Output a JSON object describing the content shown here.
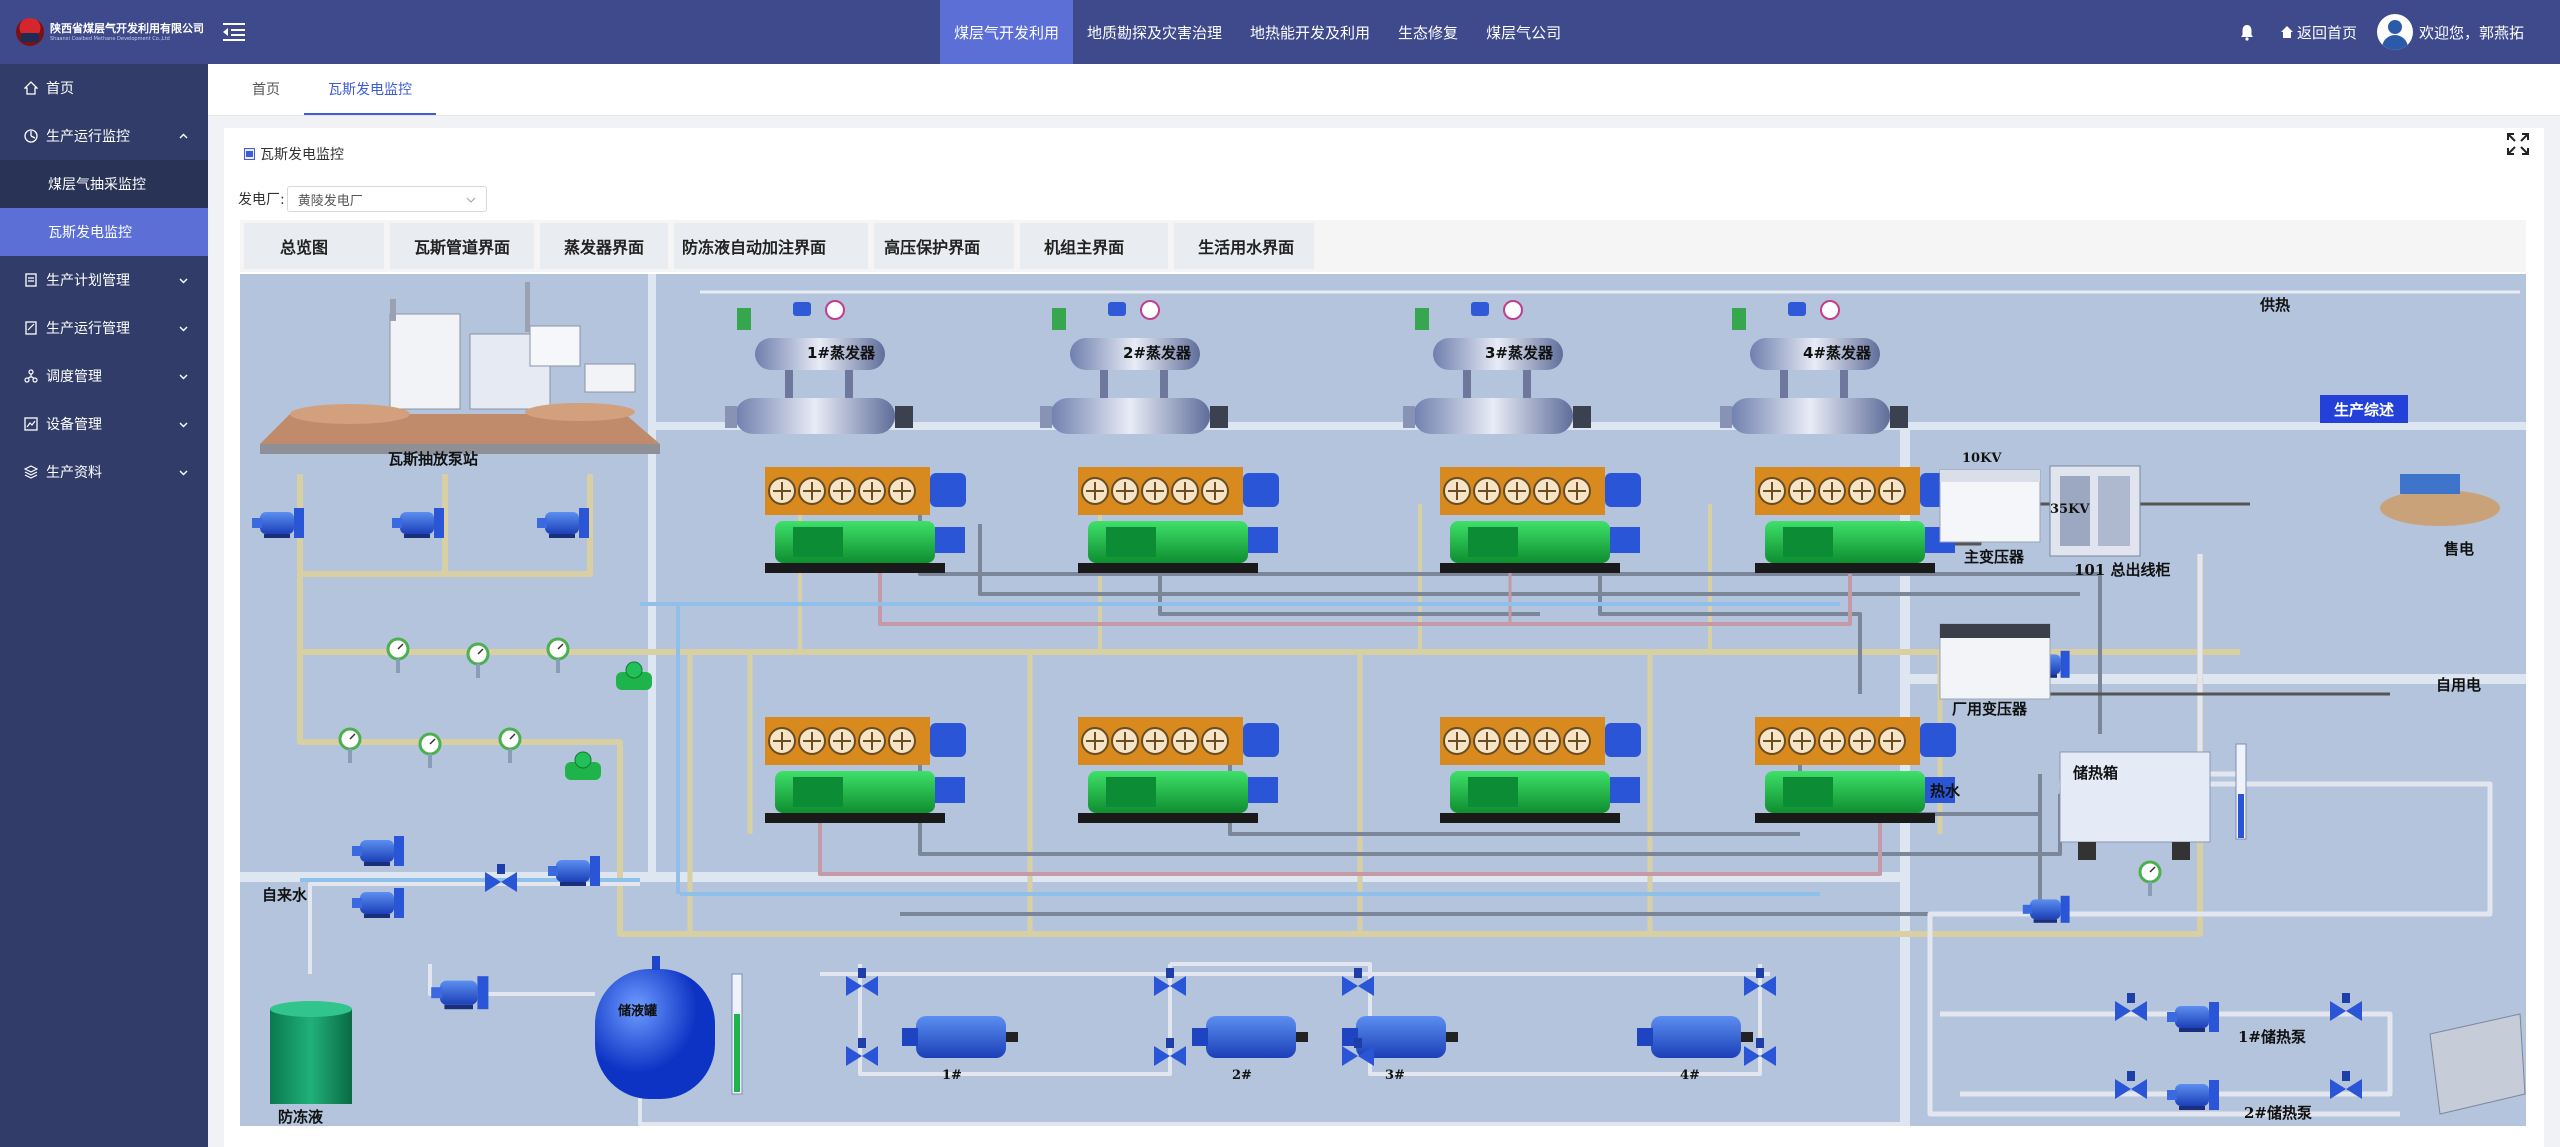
{
  "header": {
    "logo_cn": "陕西省煤层气开发利用有限公司",
    "logo_en": "Shaanxi Coalbed Methane Development Co.,Ltd",
    "nav": [
      {
        "label": "煤层气开发利用",
        "active": true
      },
      {
        "label": "地质勘探及灾害治理",
        "active": false
      },
      {
        "label": "地热能开发及利用",
        "active": false
      },
      {
        "label": "生态修复",
        "active": false
      },
      {
        "label": "煤层气公司",
        "active": false
      }
    ],
    "home_label": "返回首页",
    "welcome": "欢迎您，郭燕拓"
  },
  "sidebar": {
    "items": [
      {
        "label": "首页",
        "icon": "home-icon"
      },
      {
        "label": "生产运行监控",
        "icon": "monitor-icon",
        "expanded": true,
        "children": [
          {
            "label": "煤层气抽采监控",
            "active": false
          },
          {
            "label": "瓦斯发电监控",
            "active": true
          }
        ]
      },
      {
        "label": "生产计划管理",
        "icon": "plan-icon"
      },
      {
        "label": "生产运行管理",
        "icon": "operation-icon"
      },
      {
        "label": "调度管理",
        "icon": "dispatch-icon"
      },
      {
        "label": "设备管理",
        "icon": "equipment-icon"
      },
      {
        "label": "生产资料",
        "icon": "material-icon"
      }
    ]
  },
  "tabs": [
    {
      "label": "首页",
      "active": false
    },
    {
      "label": "瓦斯发电监控",
      "active": true
    }
  ],
  "panel": {
    "title": "瓦斯发电监控",
    "plant_label": "发电厂:",
    "plant_value": "黄陵发电厂",
    "subtabs": [
      "总览图",
      "瓦斯管道界面",
      "蒸发器界面",
      "防冻液自动加注界面",
      "高压保护界面",
      "机组主界面",
      "生活用水界面"
    ]
  },
  "diagram": {
    "pump_station": "瓦斯抽放泵站",
    "evaporators": [
      "1#蒸发器",
      "2#蒸发器",
      "3#蒸发器",
      "4#蒸发器"
    ],
    "heat_supply": "供热",
    "summary_button": "生产综述",
    "kv10": "10KV",
    "kv35": "35KV",
    "main_transformer": "主变压器",
    "outlet_cabinet": "101 总出线柜",
    "sell_power": "售电",
    "station_transformer": "厂用变压器",
    "self_use": "自用电",
    "hot_water": "热水",
    "heat_tank": "储热箱",
    "tap_water": "自来水",
    "antifreeze": "防冻液",
    "antifreeze_tank": "储液罐",
    "pumps": [
      "1#",
      "2#",
      "3#",
      "4#"
    ],
    "heat_pumps": [
      "1#储热泵",
      "2#储热泵"
    ],
    "colors": {
      "panel_bg": "#b3c4dc",
      "generator": "#1ec24a",
      "radiator": "#d98a1e",
      "pump": "#2556d8",
      "header": "#3e4a8c",
      "accent": "#5c6fd6"
    }
  }
}
